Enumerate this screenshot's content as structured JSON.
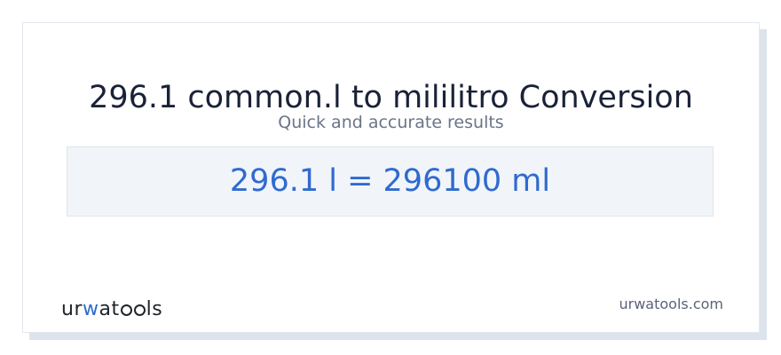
{
  "header": {
    "title": "296.1 common.l to mililitro Conversion",
    "subtitle": "Quick and accurate results"
  },
  "result": {
    "text": "296.1 l = 296100 ml"
  },
  "footer": {
    "brand_prefix": "ur",
    "brand_accent": "w",
    "brand_middle": "at",
    "brand_suffix": "ls",
    "site": "urwatools.com"
  },
  "colors": {
    "accent": "#2f6ad0",
    "title": "#1a2238",
    "muted": "#6a7488",
    "result_bg": "#f1f4f9"
  }
}
